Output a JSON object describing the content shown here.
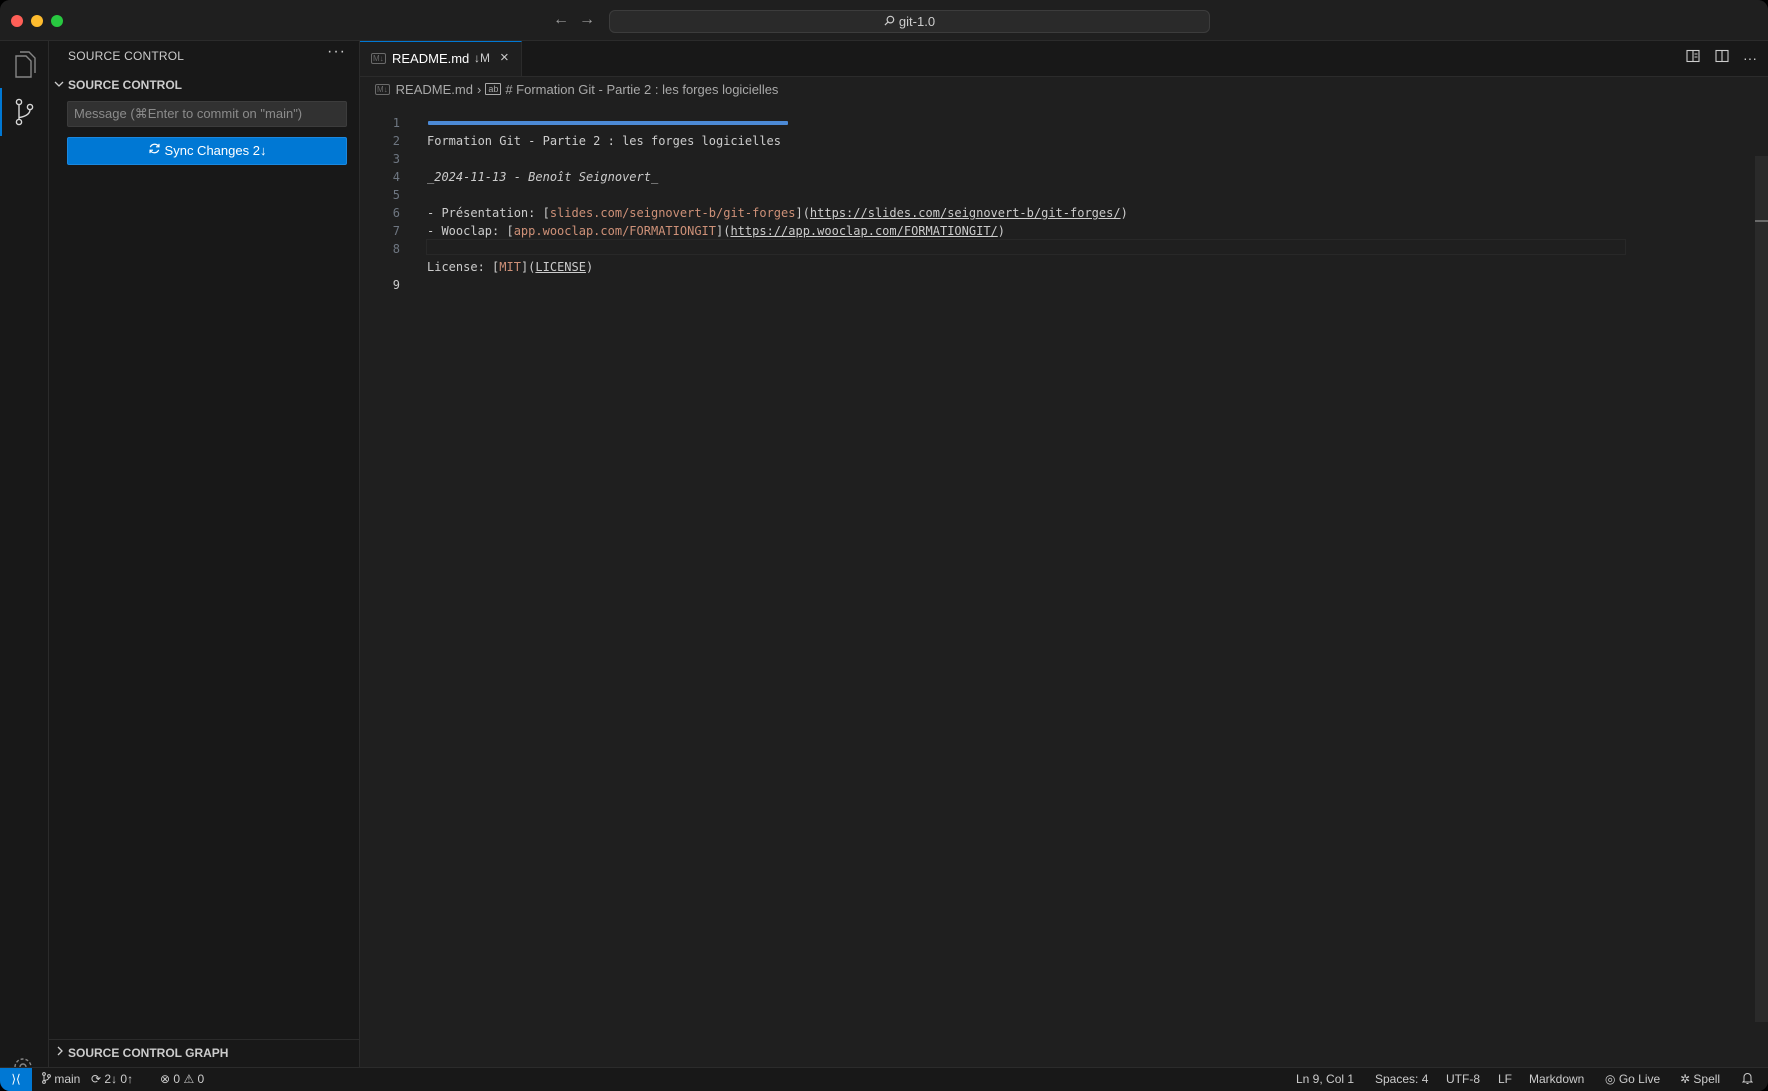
{
  "titlebar": {
    "search_label": "git-1.0",
    "back_icon": "←",
    "forward_icon": "→"
  },
  "activitybar": {
    "items": [
      "Explorer",
      "Source Control"
    ],
    "settings": "Manage"
  },
  "sidebar": {
    "title": "SOURCE CONTROL",
    "more_icon": "···",
    "section_label": "SOURCE CONTROL",
    "commit_placeholder": "Message (⌘Enter to commit on \"main\")",
    "sync_button_label": "Sync Changes 2↓",
    "graph_label": "SOURCE CONTROL GRAPH"
  },
  "editor": {
    "tab": {
      "name": "README.md",
      "state": "↓M",
      "close_icon": "×",
      "md_badge": "M↓"
    },
    "breadcrumb": {
      "file": "README.md",
      "symbol": "# Formation Git - Partie 2 : les forges logicielles",
      "md_badge": "M↓",
      "symbol_badge": "ab"
    },
    "lines": [
      {
        "n": "1",
        "text": "Formation Git - Partie 2 : les forges logicielles"
      },
      {
        "n": "2",
        "text": ""
      },
      {
        "n": "3",
        "text": "_2024-11-13 - Benoît Seignovert_"
      },
      {
        "n": "4",
        "text": ""
      },
      {
        "n": "5",
        "prefix": "- Présentation: [",
        "link": "slides.com/seignovert-b/git-forges",
        "mid": "](",
        "url": "https://slides.com/seignovert-b/git-forges/",
        "suffix": ")"
      },
      {
        "n": "6",
        "prefix": "- Wooclap: [",
        "link": "app.wooclap.com/FORMATIONGIT",
        "mid": "](",
        "url": "https://app.wooclap.com/FORMATIONGIT/",
        "suffix": ")"
      },
      {
        "n": "7",
        "text": ""
      },
      {
        "n": "8",
        "prefix": "License: [",
        "link": "MIT",
        "mid": "](",
        "url": "LICENSE",
        "suffix": ")"
      },
      {
        "n": "9",
        "text": ""
      }
    ]
  },
  "statusbar": {
    "remote_icon": "⟩⟨",
    "branch": "main",
    "sync": "2↓ 0↑",
    "errors": "0",
    "warnings": "0",
    "position": "Ln 9, Col 1",
    "spaces": "Spaces: 4",
    "encoding": "UTF-8",
    "eol": "LF",
    "language": "Markdown",
    "golive": "Go Live",
    "spell": "Spell"
  },
  "colors": {
    "accent": "#0078d4",
    "link": "#ce9178",
    "heading_rule": "#4c8ad6"
  }
}
